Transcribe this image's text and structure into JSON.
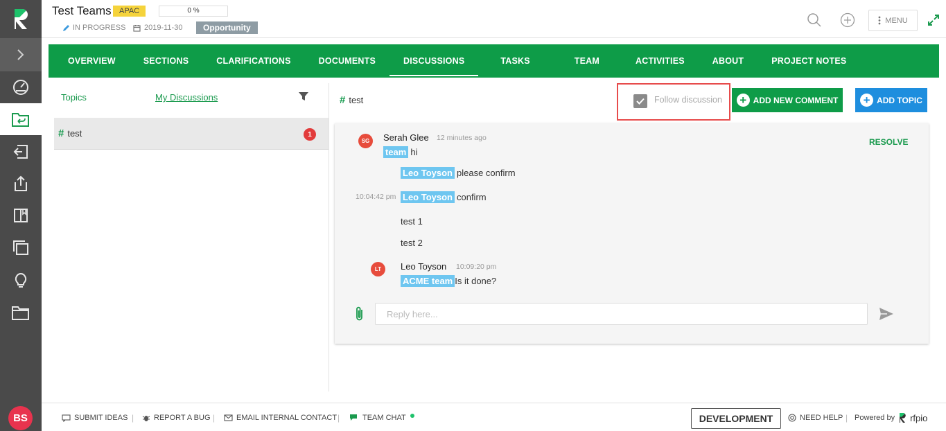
{
  "header": {
    "title": "Test Teams",
    "region": "APAC",
    "progress": "0 %",
    "status": "IN PROGRESS",
    "date": "2019-11-30",
    "type": "Opportunity",
    "menu_label": "MENU"
  },
  "tabs": [
    {
      "label": "OVERVIEW"
    },
    {
      "label": "SECTIONS"
    },
    {
      "label": "CLARIFICATIONS"
    },
    {
      "label": "DOCUMENTS"
    },
    {
      "label": "DISCUSSIONS"
    },
    {
      "label": "TASKS"
    },
    {
      "label": "TEAM"
    },
    {
      "label": "ACTIVITIES"
    },
    {
      "label": "ABOUT"
    },
    {
      "label": "PROJECT NOTES"
    }
  ],
  "active_tab": "DISCUSSIONS",
  "topics": {
    "topics_link": "Topics",
    "mine_link": "My Discussions",
    "items": [
      {
        "hash": "#",
        "name": "test",
        "unread": "1"
      }
    ]
  },
  "discussion": {
    "hash": "#",
    "title": "test",
    "follow_label": "Follow discussion",
    "add_comment_label": "ADD NEW COMMENT",
    "add_topic_label": "ADD TOPIC",
    "resolve_label": "RESOLVE",
    "reply_placeholder": "Reply here...",
    "messages": {
      "first": {
        "initials": "SG",
        "author": "Serah Glee",
        "time": "12 minutes ago",
        "mention": "team",
        "text": "hi"
      },
      "reply1": {
        "mention": "Leo Toyson",
        "text": "please confirm"
      },
      "reply2": {
        "time": "10:04:42 pm",
        "mention": "Leo Toyson",
        "text": "confirm"
      },
      "line1": "test 1",
      "line2": "test 2",
      "second": {
        "initials": "LT",
        "author": "Leo Toyson",
        "time": "10:09:20 pm",
        "mention": "ACME team",
        "text": "Is it done?"
      }
    }
  },
  "user": {
    "initials": "BS"
  },
  "footer": {
    "submit_ideas": "SUBMIT IDEAS",
    "report_bug": "REPORT A BUG",
    "email_contact": "EMAIL INTERNAL CONTACT",
    "team_chat": "TEAM CHAT",
    "environment": "DEVELOPMENT",
    "need_help": "NEED HELP",
    "powered_by": "Powered by",
    "brand": "rfpio"
  },
  "colors": {
    "brand_green": "#0e9c48",
    "accent_blue": "#1e8ede",
    "mention": "#6ec6f0",
    "highlight_border": "#e74c4c"
  }
}
